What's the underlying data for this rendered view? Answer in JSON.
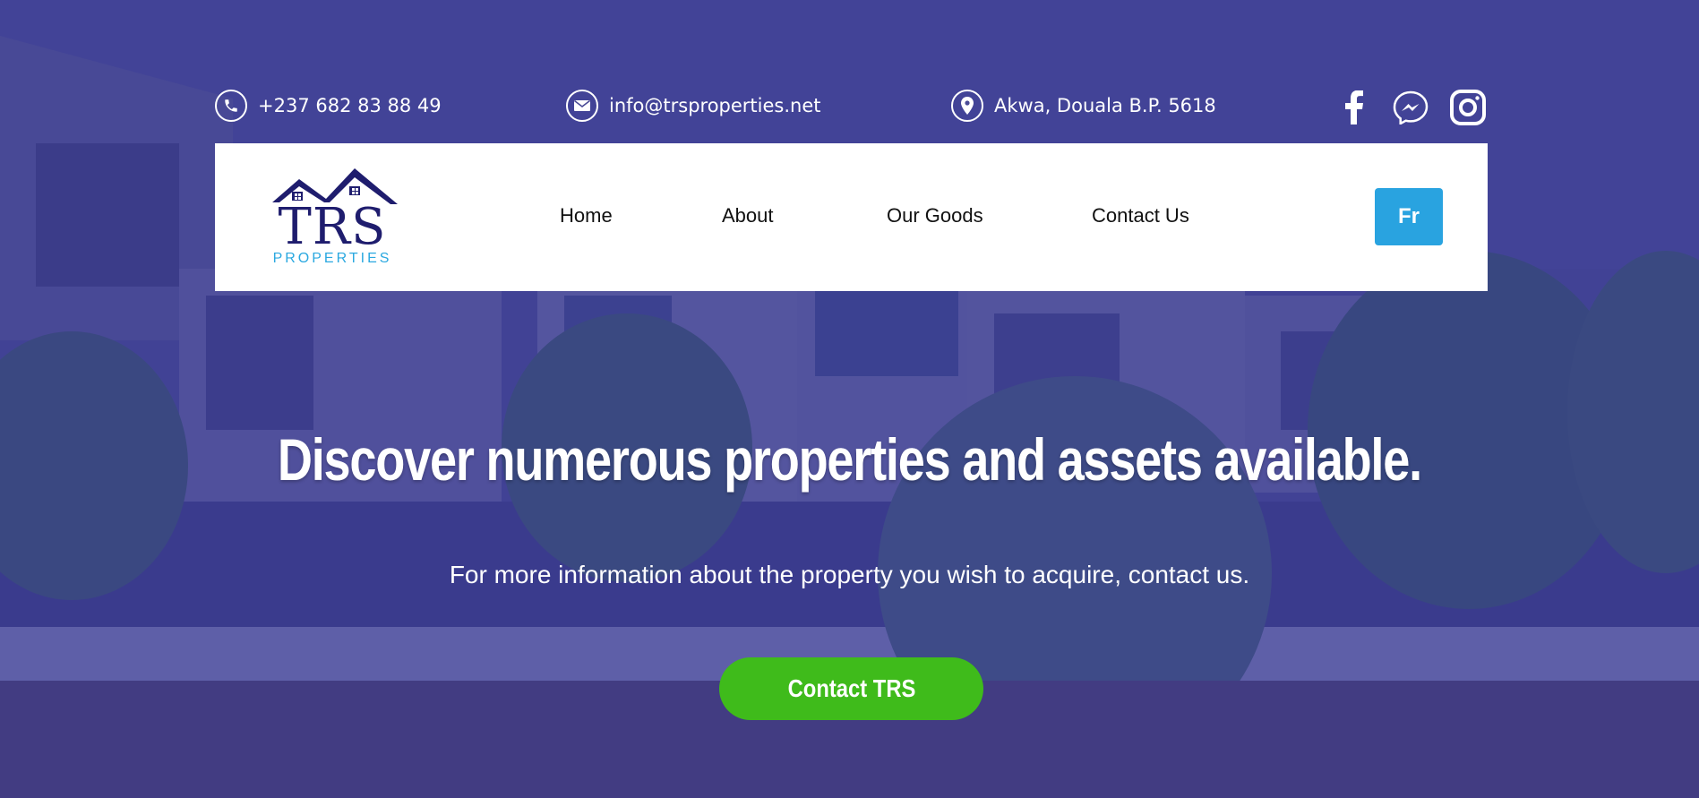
{
  "contact": {
    "phone": "+237 682 83 88 49",
    "email": "info@trsproperties.net",
    "address": "Akwa, Douala B.P. 5618"
  },
  "social": [
    "facebook-icon",
    "messenger-icon",
    "instagram-icon"
  ],
  "logo": {
    "main": "TRS",
    "sub": "PROPERTIES"
  },
  "nav": {
    "items": [
      "Home",
      "About",
      "Our Goods",
      "Contact Us"
    ],
    "language_button": "Fr"
  },
  "hero": {
    "headline": "Discover numerous properties and assets available.",
    "subline": "For more information about the property you wish to acquire, contact us.",
    "cta": "Contact TRS"
  },
  "colors": {
    "overlay": "#3b3a94",
    "brand_navy": "#1f1d6e",
    "brand_blue": "#29a3e0",
    "cta_green": "#3fbb1b"
  }
}
